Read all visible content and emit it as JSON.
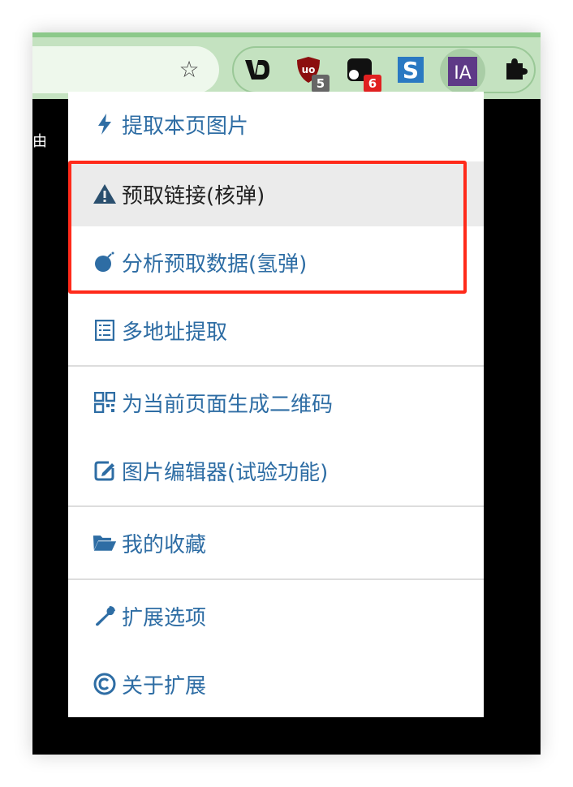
{
  "colors": {
    "toolbar_bg": "#c4e2c0",
    "menu_text": "#2e6da4",
    "active_row_bg": "#ebebeb",
    "highlight_border": "#ff2a1a"
  },
  "toolbar": {
    "bookmark_icon": "star-icon",
    "extensions": [
      {
        "name": "vd-extension-icon",
        "label": "VD"
      },
      {
        "name": "ublock-icon",
        "label": "uo",
        "badge": "5"
      },
      {
        "name": "extension-2-icon",
        "badge": "6"
      },
      {
        "name": "s-extension-icon",
        "label": "S"
      },
      {
        "name": "ia-extension-icon",
        "label": "IA"
      },
      {
        "name": "puzzle-icon"
      }
    ]
  },
  "page": {
    "left_edge_char": "由"
  },
  "menu": {
    "items": [
      {
        "label": "提取本页图片",
        "icon": "bolt-icon"
      },
      {
        "label": "预取链接(核弹)",
        "icon": "warning-icon"
      },
      {
        "label": "分析预取数据(氢弹)",
        "icon": "bomb-icon"
      },
      {
        "label": "多地址提取",
        "icon": "list-icon"
      },
      {
        "label": "为当前页面生成二维码",
        "icon": "qrcode-icon"
      },
      {
        "label": "图片编辑器(试验功能)",
        "icon": "edit-icon"
      },
      {
        "label": "我的收藏",
        "icon": "folder-open-icon"
      },
      {
        "label": "扩展选项",
        "icon": "wrench-icon"
      },
      {
        "label": "关于扩展",
        "icon": "copyright-icon"
      }
    ]
  }
}
